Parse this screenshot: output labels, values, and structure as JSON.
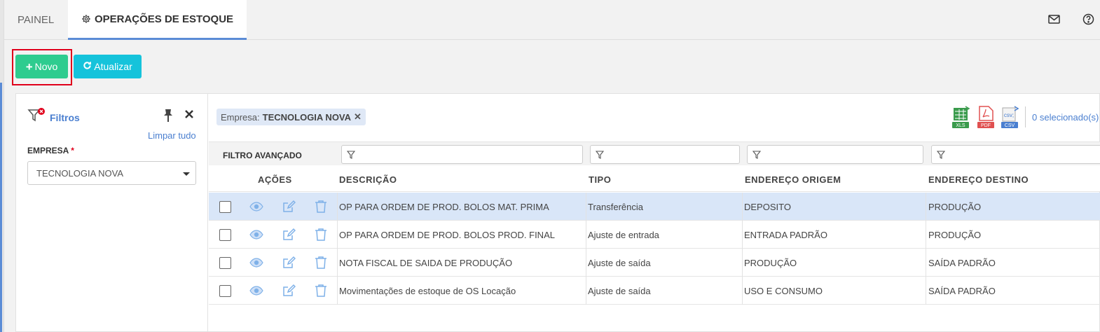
{
  "tabs": {
    "painel": "PAINEL",
    "operacoes": "OPERAÇÕES DE ESTOQUE"
  },
  "toolbar": {
    "novo_label": "Novo",
    "atualizar_label": "Atualizar"
  },
  "filters": {
    "title": "Filtros",
    "clear_all": "Limpar tudo",
    "empresa_label": "EMPRESA",
    "required_mark": "*",
    "empresa_value": "TECNOLOGIA NOVA"
  },
  "chip": {
    "label": "Empresa:",
    "value": "TECNOLOGIA NOVA"
  },
  "export": {
    "xls": "XLS",
    "pdf": "PDF",
    "csv": "CSV",
    "selected": "0 selecionado(s)"
  },
  "advanced_filter_label": "FILTRO AVANÇADO",
  "columns": {
    "acoes": "AÇÕES",
    "descricao": "DESCRIÇÃO",
    "tipo": "TIPO",
    "origem": "ENDEREÇO ORIGEM",
    "destino": "ENDEREÇO DESTINO"
  },
  "rows": [
    {
      "descricao": "OP PARA ORDEM DE PROD. BOLOS MAT. PRIMA",
      "tipo": "Transferência",
      "origem": "DEPOSITO",
      "destino": "PRODUÇÃO",
      "selected": true
    },
    {
      "descricao": "OP PARA ORDEM DE PROD. BOLOS PROD. FINAL",
      "tipo": "Ajuste de entrada",
      "origem": "ENTRADA PADRÃO",
      "destino": "PRODUÇÃO",
      "selected": false
    },
    {
      "descricao": "NOTA FISCAL DE SAIDA DE PRODUÇÃO",
      "tipo": "Ajuste de saída",
      "origem": "PRODUÇÃO",
      "destino": "SAÍDA PADRÃO",
      "selected": false
    },
    {
      "descricao": "Movimentações de estoque de OS Locação",
      "tipo": "Ajuste de saída",
      "origem": "USO E CONSUMO",
      "destino": "SAÍDA PADRÃO",
      "selected": false
    }
  ],
  "colors": {
    "accent": "#4a7fd0",
    "novo": "#2ecc8f",
    "atualizar": "#15c3db",
    "highlight": "#e0001b",
    "row_selected": "#d9e6f8"
  }
}
